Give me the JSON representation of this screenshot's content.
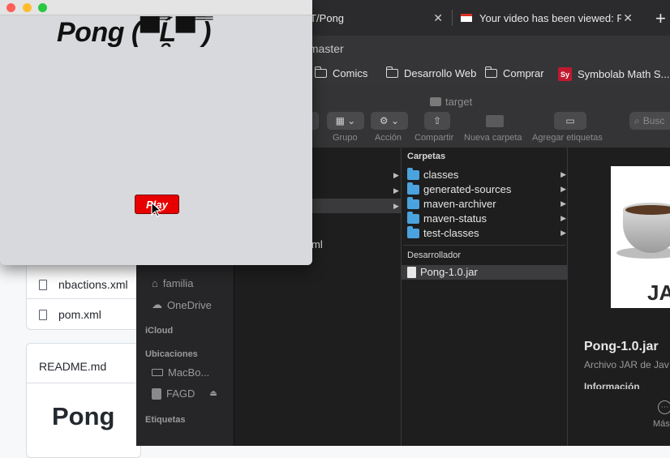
{
  "browser": {
    "tabs": [
      {
        "title": "GT/Pong"
      },
      {
        "title": "Your video has been viewed: P"
      }
    ],
    "new_tab": "+",
    "tab_close": "✕",
    "url": "/master",
    "bookmarks": [
      "Comics",
      "Desarrollo Web",
      "Comprar",
      "Symbolab Math S..."
    ],
    "bookmark_sy": "Sy"
  },
  "github": {
    "files": [
      "nbactions.xml",
      "pom.xml"
    ],
    "readme_header": "README.md",
    "readme_title": "Pong"
  },
  "finder": {
    "title": "target",
    "toolbar": [
      {
        "label": "Grupo",
        "icon": "grid-icon"
      },
      {
        "label": "Acción",
        "icon": "gear-icon"
      },
      {
        "label": "Compartir",
        "icon": "share-icon"
      },
      {
        "label": "Nueva carpeta",
        "icon": "new-folder-icon"
      },
      {
        "label": "Agregar etiquetas",
        "icon": "tag-icon"
      }
    ],
    "search_placeholder": "Busc",
    "sidebar": {
      "items": [
        "familia",
        "OneDrive"
      ],
      "icloud": "iCloud",
      "ubicaciones": "Ubicaciones",
      "locations": [
        "MacBo...",
        "FAGD"
      ],
      "etiquetas": "Etiquetas"
    },
    "col2_partial": "ml",
    "col3": {
      "header": "Carpetas",
      "folders": [
        "classes",
        "generated-sources",
        "maven-archiver",
        "maven-status",
        "test-classes"
      ],
      "dev_header": "Desarrollador",
      "jar": "Pong-1.0.jar"
    },
    "preview": {
      "image_label": "JA",
      "name": "Pong-1.0.jar",
      "kind": "Archivo JAR de Jav",
      "info": "Información",
      "more": "Más"
    }
  },
  "pong": {
    "title": "Pong (▀̿Ĺ̯▀̿ ̿)",
    "play_label": "Play"
  },
  "colors": {
    "play_button": "#e80000",
    "folder_blue": "#4aa3df",
    "traffic_red": "#ff5f57",
    "traffic_yellow": "#febc2e",
    "traffic_green": "#28c840"
  }
}
